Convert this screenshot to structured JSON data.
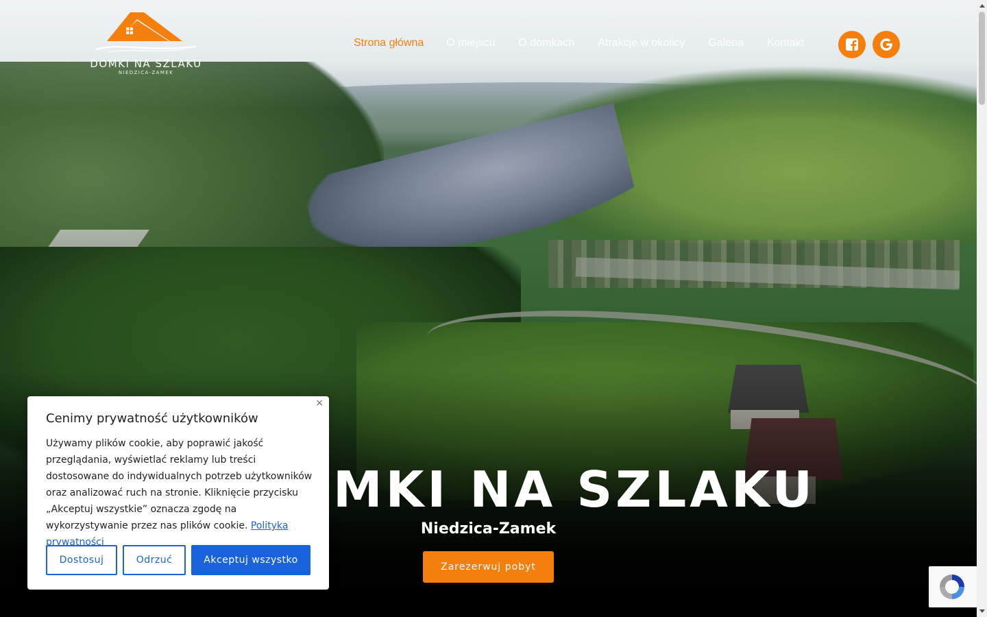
{
  "logo": {
    "name": "DOMKI NA SZLAKU",
    "subtitle": "NIEDZICA-ZAMEK"
  },
  "nav": {
    "items": [
      {
        "label": "Strona główna",
        "active": true
      },
      {
        "label": "O miejscu",
        "active": false
      },
      {
        "label": "O domkach",
        "active": false
      },
      {
        "label": "Atrakcje w okolicy",
        "active": false
      },
      {
        "label": "Galeria",
        "active": false
      },
      {
        "label": "Kontakt",
        "active": false
      }
    ]
  },
  "social": {
    "facebook_icon": "facebook-icon",
    "google_icon": "google-icon"
  },
  "hero": {
    "title": "DOMKI NA SZLAKU",
    "subtitle": "Niedzica-Zamek",
    "cta_label": "Zarezerwuj pobyt"
  },
  "cookie": {
    "close_symbol": "×",
    "title": "Cenimy prywatność użytkowników",
    "body": "Używamy plików cookie, aby poprawić jakość przeglądania, wyświetlać reklamy lub treści dostosowane do indywidualnych potrzeb użytkowników oraz analizować ruch na stronie. Kliknięcie przycisku „Akceptuj wszystkie” oznacza zgodę na wykorzystywanie przez nas plików cookie.",
    "policy_link": "Polityka prywatności",
    "customize_label": "Dostosuj",
    "reject_label": "Odrzuć",
    "accept_label": "Akceptuj wszystko"
  },
  "colors": {
    "accent": "#f47f0d",
    "cookie_primary": "#1863dc"
  }
}
